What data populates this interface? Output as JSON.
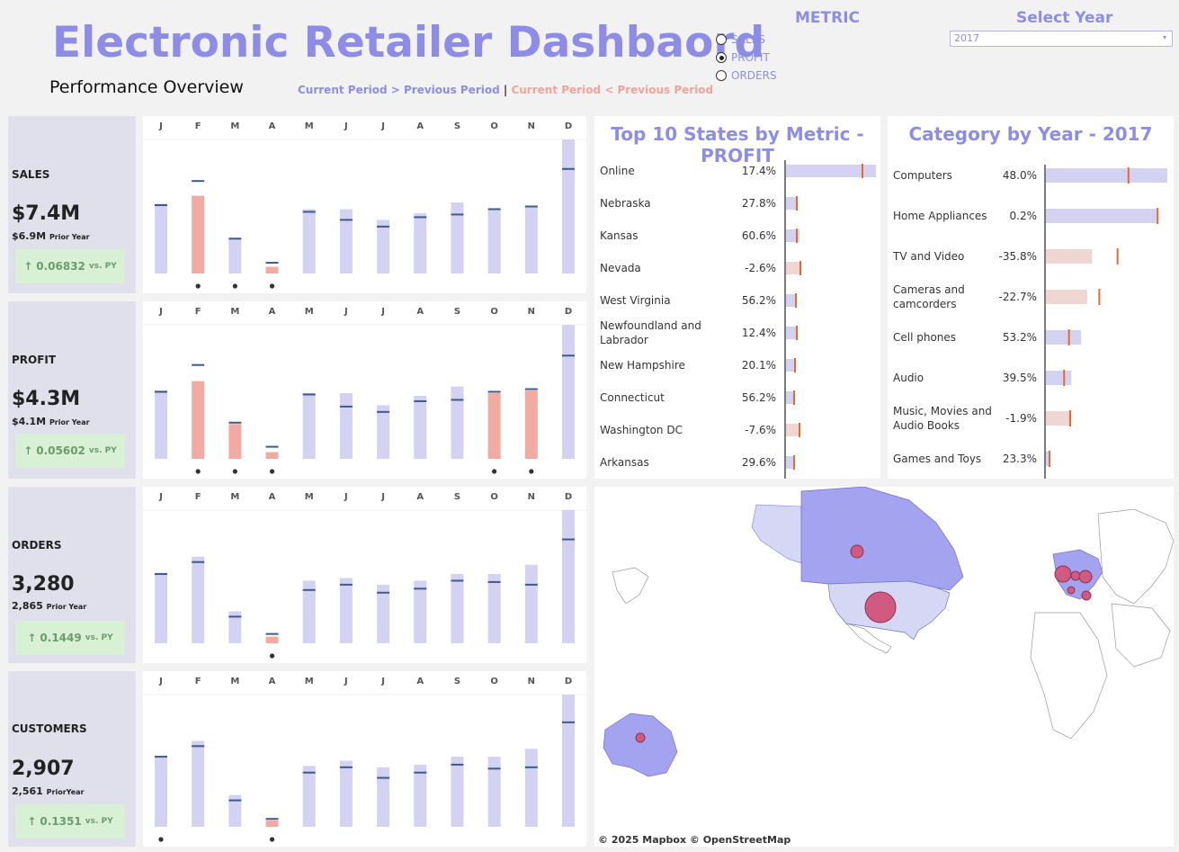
{
  "header": {
    "title": "Electronic Retailer Dashbaord",
    "subtitle": "Performance Overview",
    "legend_up": "Current Period > Previous Period",
    "legend_sep": "|",
    "legend_down": "Current Period < Previous Period"
  },
  "metric": {
    "title": "METRIC",
    "options": [
      "SALES",
      "PROFIT",
      "ORDERS"
    ],
    "selected": "PROFIT"
  },
  "year": {
    "title": "Select Year",
    "value": "2017",
    "arrow": "▾"
  },
  "kpis": [
    {
      "name": "SALES",
      "value": "$7.4M",
      "prior": "$6.9M",
      "prior_label": "Prior Year",
      "change": "0.06832",
      "vs": "vs. PY",
      "arrow": "↑"
    },
    {
      "name": "PROFIT",
      "value": "$4.3M",
      "prior": "$4.1M",
      "prior_label": "Prior Year",
      "change": "0.05602",
      "vs": "vs. PY",
      "arrow": "↑"
    },
    {
      "name": "ORDERS",
      "value": "3,280",
      "prior": "2,865",
      "prior_label": "Prior Year",
      "change": "0.1449",
      "vs": "vs. PY",
      "arrow": "↑"
    },
    {
      "name": "CUSTOMERS",
      "value": "2,907",
      "prior": "2,561",
      "prior_label": "PriorYear",
      "change": "0.1351",
      "vs": "vs. PY",
      "arrow": "↑"
    }
  ],
  "months": [
    "J",
    "F",
    "M",
    "A",
    "M",
    "J",
    "J",
    "A",
    "S",
    "O",
    "N",
    "D"
  ],
  "chart_data": [
    {
      "type": "bar",
      "metric": "SALES",
      "categories": [
        "J",
        "F",
        "M",
        "A",
        "M",
        "J",
        "J",
        "A",
        "S",
        "O",
        "N",
        "D"
      ],
      "current": [
        0.52,
        0.58,
        0.26,
        0.05,
        0.48,
        0.48,
        0.4,
        0.45,
        0.53,
        0.48,
        0.5,
        1.0
      ],
      "prior": [
        0.51,
        0.69,
        0.26,
        0.08,
        0.46,
        0.4,
        0.35,
        0.42,
        0.44,
        0.48,
        0.5,
        0.78
      ],
      "dots": [
        false,
        true,
        true,
        true,
        false,
        false,
        false,
        false,
        false,
        false,
        false,
        false
      ]
    },
    {
      "type": "bar",
      "metric": "PROFIT",
      "categories": [
        "J",
        "F",
        "M",
        "A",
        "M",
        "J",
        "J",
        "A",
        "S",
        "O",
        "N",
        "D"
      ],
      "current": [
        0.51,
        0.58,
        0.26,
        0.05,
        0.49,
        0.49,
        0.4,
        0.47,
        0.54,
        0.49,
        0.51,
        1.0
      ],
      "prior": [
        0.5,
        0.7,
        0.27,
        0.09,
        0.48,
        0.39,
        0.35,
        0.43,
        0.44,
        0.5,
        0.52,
        0.77
      ],
      "dots": [
        false,
        true,
        true,
        true,
        false,
        false,
        false,
        false,
        false,
        true,
        true,
        false
      ]
    },
    {
      "type": "bar",
      "metric": "ORDERS",
      "categories": [
        "J",
        "F",
        "M",
        "A",
        "M",
        "J",
        "J",
        "A",
        "S",
        "O",
        "N",
        "D"
      ],
      "current": [
        0.53,
        0.65,
        0.24,
        0.05,
        0.47,
        0.49,
        0.44,
        0.47,
        0.52,
        0.52,
        0.59,
        1.0
      ],
      "prior": [
        0.52,
        0.61,
        0.2,
        0.07,
        0.4,
        0.44,
        0.38,
        0.41,
        0.47,
        0.46,
        0.44,
        0.78
      ],
      "dots": [
        false,
        false,
        false,
        true,
        false,
        false,
        false,
        false,
        false,
        false,
        false,
        false
      ]
    },
    {
      "type": "bar",
      "metric": "CUSTOMERS",
      "categories": [
        "J",
        "F",
        "M",
        "A",
        "M",
        "J",
        "J",
        "A",
        "S",
        "O",
        "N",
        "D"
      ],
      "current": [
        0.53,
        0.65,
        0.24,
        0.05,
        0.46,
        0.5,
        0.45,
        0.47,
        0.53,
        0.53,
        0.59,
        1.0
      ],
      "prior": [
        0.53,
        0.61,
        0.2,
        0.06,
        0.41,
        0.45,
        0.37,
        0.41,
        0.47,
        0.44,
        0.45,
        0.79
      ],
      "dots": [
        true,
        false,
        false,
        true,
        false,
        false,
        false,
        false,
        false,
        false,
        false,
        false
      ]
    },
    {
      "type": "bar",
      "title": "Top 10 States by Metric - PROFIT",
      "categories": [
        "Online",
        "Nebraska",
        "Kansas",
        "Nevada",
        "West Virginia",
        "Newfoundland and Labrador",
        "New Hampshire",
        "Connecticut",
        "Washington DC",
        "Arkansas"
      ],
      "percent_labels": [
        "17.4%",
        "27.8%",
        "60.6%",
        "-2.6%",
        "56.2%",
        "12.4%",
        "20.1%",
        "56.2%",
        "-7.6%",
        "29.6%"
      ],
      "values": [
        1.0,
        0.13,
        0.15,
        0.16,
        0.12,
        0.12,
        0.1,
        0.1,
        0.14,
        0.09
      ],
      "prior_values": [
        0.85,
        0.12,
        0.12,
        0.16,
        0.11,
        0.12,
        0.1,
        0.09,
        0.15,
        0.09
      ],
      "negative": [
        false,
        false,
        false,
        true,
        false,
        false,
        false,
        false,
        true,
        false
      ]
    },
    {
      "type": "bar",
      "title": "Category by Year - 2017",
      "categories": [
        "Computers",
        "Home Appliances",
        "TV and Video",
        "Cameras and camcorders",
        "Cell phones",
        "Audio",
        "Music, Movies and Audio Books",
        "Games and Toys"
      ],
      "percent_labels": [
        "48.0%",
        "0.2%",
        "-35.8%",
        "-22.7%",
        "53.2%",
        "39.5%",
        "-1.9%",
        "23.3%"
      ],
      "values": [
        1.0,
        0.92,
        0.38,
        0.34,
        0.29,
        0.21,
        0.2,
        0.03
      ],
      "prior_values": [
        0.68,
        0.92,
        0.59,
        0.44,
        0.19,
        0.15,
        0.2,
        0.03
      ],
      "negative": [
        false,
        false,
        true,
        true,
        false,
        false,
        true,
        false
      ]
    }
  ],
  "map": {
    "credit": "© 2025 Mapbox  © OpenStreetMap"
  }
}
